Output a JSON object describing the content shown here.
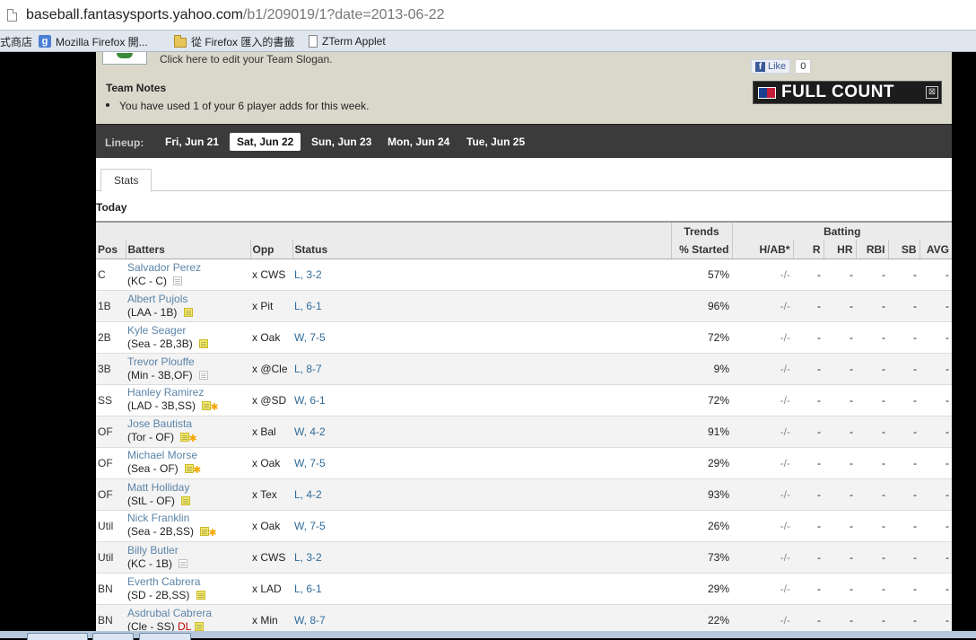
{
  "browser": {
    "url_host": "baseball.fantasysports.yahoo.com",
    "url_path": "/b1/209019/1?date=2013-06-22",
    "bookmarks": [
      {
        "label": "式商店",
        "icon": "none"
      },
      {
        "label": "Mozilla Firefox 開...",
        "icon": "google-icon"
      },
      {
        "label": "從 Firefox 匯入的書籤",
        "icon": "folder-icon"
      },
      {
        "label": "ZTerm Applet",
        "icon": "page-icon"
      }
    ]
  },
  "team": {
    "slogan_link": "Click here to edit your Team Slogan.",
    "notes_title": "Team Notes",
    "note": "You have used 1 of your 6 player adds for this week.",
    "like_label": "Like",
    "like_count": "0",
    "fullcount_label": "FULL COUNT",
    "fullcount_close": "⊠"
  },
  "lineup": {
    "label": "Lineup:",
    "days": [
      "Fri, Jun 21",
      "Sat, Jun 22",
      "Sun, Jun 23",
      "Mon, Jun 24",
      "Tue, Jun 25"
    ],
    "active_index": 1
  },
  "tabs": {
    "stats": "Stats"
  },
  "section_title": "Today",
  "table": {
    "group_headers": {
      "trends": "Trends",
      "batting": "Batting"
    },
    "headers": {
      "pos": "Pos",
      "batters": "Batters",
      "opp": "Opp",
      "status": "Status",
      "started": "% Started",
      "hab": "H/AB*",
      "r": "R",
      "hr": "HR",
      "rbi": "RBI",
      "sb": "SB",
      "avg": "AVG"
    },
    "rows": [
      {
        "pos": "C",
        "name": "Salvador Perez",
        "team": "(KC - C)",
        "dl": "",
        "note": "grey",
        "star": false,
        "opp": "x CWS",
        "status": "L, 3-2",
        "started": "57%",
        "hab": "-/-",
        "r": "-",
        "hr": "-",
        "rbi": "-",
        "sb": "-",
        "avg": "-"
      },
      {
        "pos": "1B",
        "name": "Albert Pujols",
        "team": "(LAA - 1B)",
        "dl": "",
        "note": "yellow",
        "star": false,
        "opp": "x Pit",
        "status": "L, 6-1",
        "started": "96%",
        "hab": "-/-",
        "r": "-",
        "hr": "-",
        "rbi": "-",
        "sb": "-",
        "avg": "-"
      },
      {
        "pos": "2B",
        "name": "Kyle Seager",
        "team": "(Sea - 2B,3B)",
        "dl": "",
        "note": "yellow",
        "star": false,
        "opp": "x Oak",
        "status": "W, 7-5",
        "started": "72%",
        "hab": "-/-",
        "r": "-",
        "hr": "-",
        "rbi": "-",
        "sb": "-",
        "avg": "-"
      },
      {
        "pos": "3B",
        "name": "Trevor Plouffe",
        "team": "(Min - 3B,OF)",
        "dl": "",
        "note": "grey",
        "star": false,
        "opp": "x @Cle",
        "status": "L, 8-7",
        "started": "9%",
        "hab": "-/-",
        "r": "-",
        "hr": "-",
        "rbi": "-",
        "sb": "-",
        "avg": "-"
      },
      {
        "pos": "SS",
        "name": "Hanley Ramirez",
        "team": "(LAD - 3B,SS)",
        "dl": "",
        "note": "yellow",
        "star": true,
        "opp": "x @SD",
        "status": "W, 6-1",
        "started": "72%",
        "hab": "-/-",
        "r": "-",
        "hr": "-",
        "rbi": "-",
        "sb": "-",
        "avg": "-"
      },
      {
        "pos": "OF",
        "name": "Jose Bautista",
        "team": "(Tor - OF)",
        "dl": "",
        "note": "yellow",
        "star": true,
        "opp": "x Bal",
        "status": "W, 4-2",
        "started": "91%",
        "hab": "-/-",
        "r": "-",
        "hr": "-",
        "rbi": "-",
        "sb": "-",
        "avg": "-"
      },
      {
        "pos": "OF",
        "name": "Michael Morse",
        "team": "(Sea - OF)",
        "dl": "",
        "note": "yellow",
        "star": true,
        "opp": "x Oak",
        "status": "W, 7-5",
        "started": "29%",
        "hab": "-/-",
        "r": "-",
        "hr": "-",
        "rbi": "-",
        "sb": "-",
        "avg": "-"
      },
      {
        "pos": "OF",
        "name": "Matt Holliday",
        "team": "(StL - OF)",
        "dl": "",
        "note": "yellow",
        "star": false,
        "opp": "x Tex",
        "status": "L, 4-2",
        "started": "93%",
        "hab": "-/-",
        "r": "-",
        "hr": "-",
        "rbi": "-",
        "sb": "-",
        "avg": "-"
      },
      {
        "pos": "Util",
        "name": "Nick Franklin",
        "team": "(Sea - 2B,SS)",
        "dl": "",
        "note": "yellow",
        "star": true,
        "opp": "x Oak",
        "status": "W, 7-5",
        "started": "26%",
        "hab": "-/-",
        "r": "-",
        "hr": "-",
        "rbi": "-",
        "sb": "-",
        "avg": "-"
      },
      {
        "pos": "Util",
        "name": "Billy Butler",
        "team": "(KC - 1B)",
        "dl": "",
        "note": "grey",
        "star": false,
        "opp": "x CWS",
        "status": "L, 3-2",
        "started": "73%",
        "hab": "-/-",
        "r": "-",
        "hr": "-",
        "rbi": "-",
        "sb": "-",
        "avg": "-"
      },
      {
        "pos": "BN",
        "name": "Everth Cabrera",
        "team": "(SD - 2B,SS)",
        "dl": "",
        "note": "yellow",
        "star": false,
        "opp": "x LAD",
        "status": "L, 6-1",
        "started": "29%",
        "hab": "-/-",
        "r": "-",
        "hr": "-",
        "rbi": "-",
        "sb": "-",
        "avg": "-"
      },
      {
        "pos": "BN",
        "name": "Asdrubal Cabrera",
        "team": "(Cle - SS)",
        "dl": "DL",
        "note": "yellow",
        "star": false,
        "opp": "x Min",
        "status": "W, 8-7",
        "started": "22%",
        "hab": "-/-",
        "r": "-",
        "hr": "-",
        "rbi": "-",
        "sb": "-",
        "avg": "-"
      }
    ]
  },
  "colors": {
    "link": "#5b84a8",
    "status_link": "#2f6b9a",
    "lineup_bar": "#3b3b3b",
    "team_header": "#d9d8cb",
    "pct_started_header": "#e4e6c8"
  }
}
